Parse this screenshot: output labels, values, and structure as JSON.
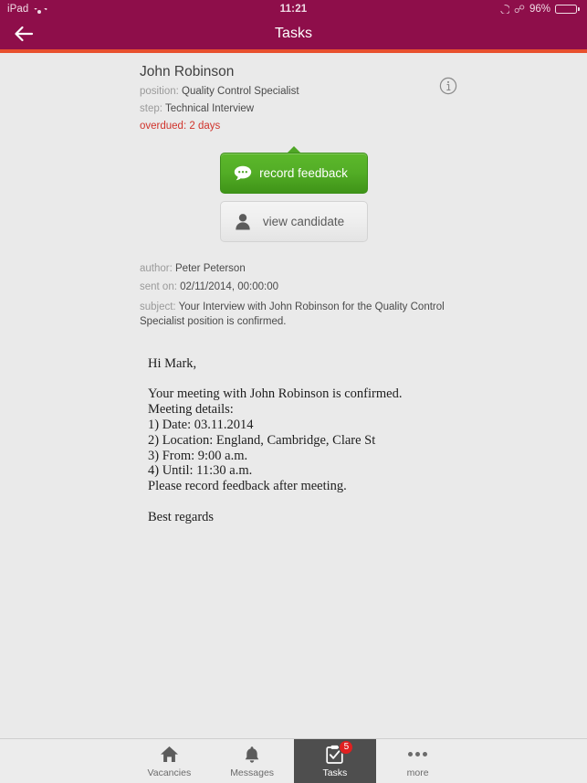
{
  "status_bar": {
    "device": "iPad",
    "wifi_icon": "wifi-icon",
    "time": "11:21",
    "dnd_icon": "moon-icon",
    "bluetooth_icon": "bluetooth-icon",
    "battery_percent": "96%",
    "battery_icon": "battery-icon"
  },
  "nav": {
    "back_icon": "back-arrow-icon",
    "title": "Tasks",
    "header_color": "#8E0E4A",
    "accent_color": "#E8502E"
  },
  "task": {
    "candidate_name": "John Robinson",
    "position_label": "position:",
    "position_value": "Quality Control Specialist",
    "step_label": "step:",
    "step_value": "Technical Interview",
    "overdue_label": "overdued:",
    "overdue_value": "2 days",
    "overdue_color": "#d0342c",
    "info_icon": "info-circle-icon"
  },
  "actions": {
    "record_feedback": {
      "label": "record feedback",
      "icon": "speech-bubble-icon",
      "color": "#4fa626"
    },
    "view_candidate": {
      "label": "view candidate",
      "icon": "person-icon"
    }
  },
  "message": {
    "author_label": "author:",
    "author_value": "Peter Peterson",
    "sent_label": "sent on:",
    "sent_value": "02/11/2014, 00:00:00",
    "subject_label": "subject:",
    "subject_value": "Your Interview with John Robinson for the Quality Control Specialist position is confirmed."
  },
  "email_body": {
    "greeting": "Hi Mark,",
    "line1": "Your meeting with John Robinson is confirmed.",
    "line2": "Meeting details:",
    "line3": "1) Date: 03.11.2014",
    "line4": "2) Location: England, Cambridge, Clare St",
    "line5": "3) From: 9:00 a.m.",
    "line6": "4) Until: 11:30 a.m.",
    "line7": "Please record feedback after meeting.",
    "closing": "Best regards"
  },
  "tab_bar": {
    "tabs": [
      {
        "label": "Vacancies",
        "icon": "home-icon",
        "active": false,
        "badge": ""
      },
      {
        "label": "Messages",
        "icon": "bell-icon",
        "active": false,
        "badge": ""
      },
      {
        "label": "Tasks",
        "icon": "clipboard-check-icon",
        "active": true,
        "badge": "5"
      },
      {
        "label": "more",
        "icon": "ellipsis-icon",
        "active": false,
        "badge": ""
      }
    ],
    "badge_color": "#e02020",
    "active_bg": "#4e4e4e"
  }
}
